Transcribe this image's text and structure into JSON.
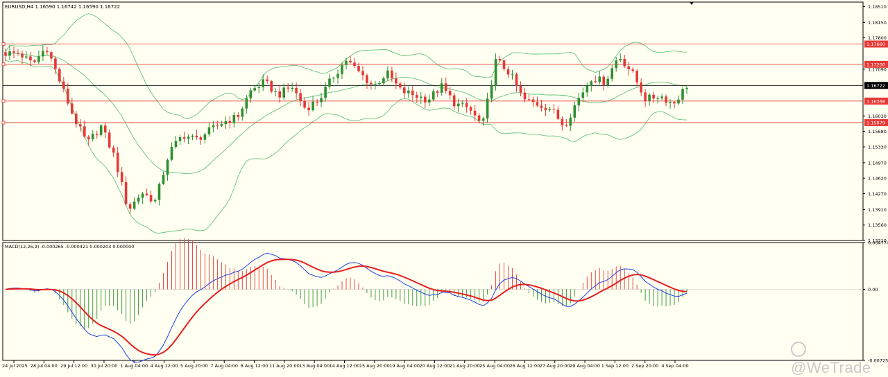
{
  "header": {
    "symbol": "EURUSD,H4",
    "ohlc": "1.16590 1.16742 1.16590 1.16722"
  },
  "macd_header": {
    "label": "MACD(12,26,9) -0.000265 -0.000421 0.000203 0.000000"
  },
  "watermark": {
    "text": "@WeTrade",
    "icon": "wetrade-logo-icon"
  },
  "colors": {
    "background": "#fffff2",
    "bull": "#2f8f2f",
    "bear": "#e53935",
    "bands": "#63c27a",
    "levels": "#e53935",
    "current_price_line": "#000000",
    "macd_line": "#1f3fe0",
    "signal_line": "#e61e1e"
  },
  "chart_data": [
    {
      "type": "candlestick",
      "symbol": "EURUSD",
      "timeframe": "H4",
      "ylim": [
        1.1321,
        1.1861
      ],
      "y_ticks": [
        "1.18510",
        "1.18150",
        "1.17800",
        "1.17090",
        "1.16030",
        "1.15680",
        "1.15330",
        "1.14970",
        "1.14620",
        "1.14270",
        "1.13910",
        "1.13560",
        "1.13210"
      ],
      "x_ticks": [
        "24 Jul 2025",
        "28 Jul 04:00",
        "29 Jul 12:00",
        "30 Jul 20:00",
        "1 Aug 04:00",
        "4 Aug 12:00",
        "5 Aug 20:00",
        "7 Aug 04:00",
        "8 Aug 12:00",
        "11 Aug 20:00",
        "13 Aug 04:00",
        "14 Aug 12:00",
        "15 Aug 20:00",
        "19 Aug 04:00",
        "20 Aug 12:00",
        "21 Aug 20:00",
        "25 Aug 04:00",
        "26 Aug 12:00",
        "27 Aug 20:00",
        "29 Aug 04:00",
        "1 Sep 12:00",
        "2 Sep 20:00",
        "4 Sep 04:00"
      ],
      "close_waypoints": [
        1.1745,
        1.1745,
        1.172,
        1.176,
        1.168,
        1.16,
        1.154,
        1.158,
        1.151,
        1.139,
        1.143,
        1.141,
        1.152,
        1.156,
        1.155,
        1.157,
        1.159,
        1.16,
        1.166,
        1.168,
        1.165,
        1.167,
        1.162,
        1.164,
        1.169,
        1.173,
        1.17,
        1.167,
        1.17,
        1.166,
        1.165,
        1.164,
        1.167,
        1.163,
        1.162,
        1.158,
        1.173,
        1.17,
        1.164,
        1.163,
        1.162,
        1.158,
        1.164,
        1.169,
        1.168,
        1.174,
        1.17,
        1.164,
        1.165,
        1.163,
        1.16722
      ],
      "horizontal_levels": [
        {
          "label": "1.17660",
          "value": 1.1766,
          "color": "#e53935"
        },
        {
          "label": "1.17200",
          "value": 1.172,
          "color": "#e53935"
        },
        {
          "label": "1.16722",
          "value": 1.16722,
          "color": "#000000"
        },
        {
          "label": "1.16368",
          "value": 1.16368,
          "color": "#e53935"
        },
        {
          "label": "1.15879",
          "value": 1.15879,
          "color": "#e53935"
        }
      ],
      "bollinger_bands": {
        "period": 20,
        "deviation": 2
      }
    },
    {
      "type": "macd",
      "params": "12,26,9",
      "ylim": [
        -0.007257,
        0.004774
      ],
      "y_ticks": [
        "0.004774",
        "0.00",
        "-0.007257"
      ]
    }
  ]
}
